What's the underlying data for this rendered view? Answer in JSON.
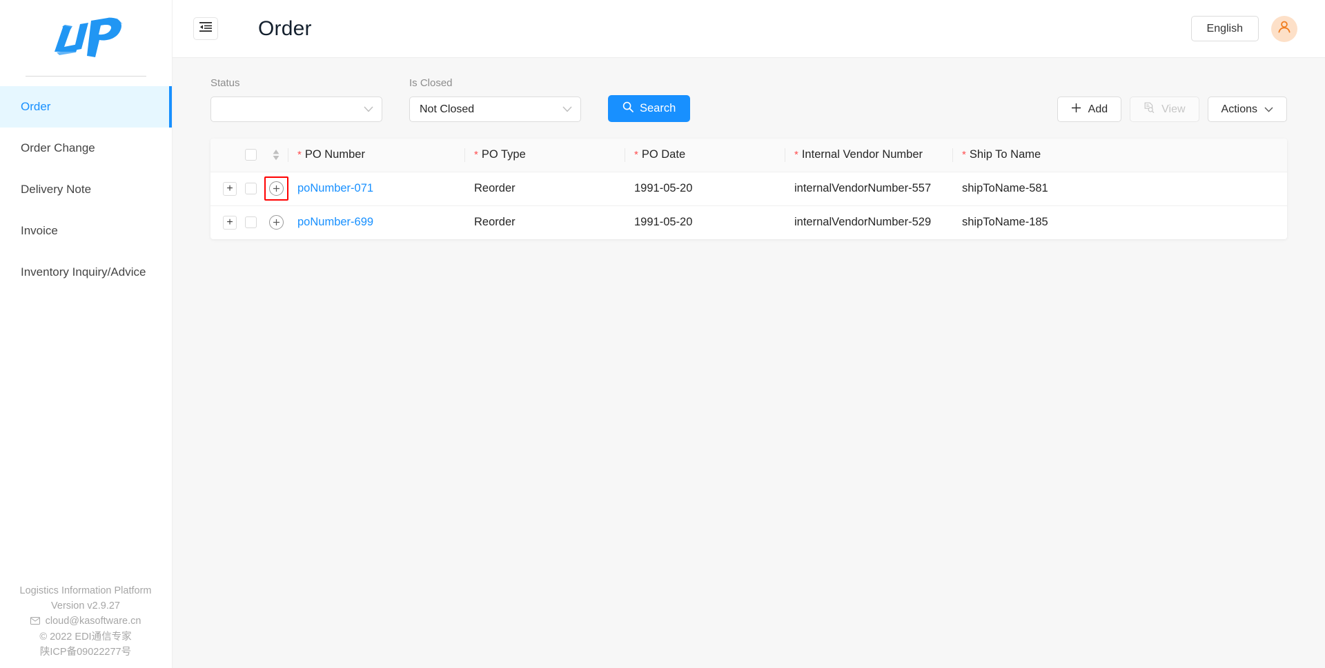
{
  "sidebar": {
    "logo_text": "LIP",
    "items": [
      {
        "label": "Order",
        "active": true
      },
      {
        "label": "Order Change",
        "active": false
      },
      {
        "label": "Delivery Note",
        "active": false
      },
      {
        "label": "Invoice",
        "active": false
      },
      {
        "label": "Inventory Inquiry/Advice",
        "active": false
      }
    ],
    "footer": {
      "platform": "Logistics Information Platform",
      "version": "Version v2.9.27",
      "email": "cloud@kasoftware.cn",
      "copyright": "© 2022 EDI通信专家",
      "icp": "陕ICP备09022277号"
    }
  },
  "topbar": {
    "collapse_icon": "menu-fold-icon",
    "title": "Order",
    "language_label": "English",
    "avatar_icon": "user-icon"
  },
  "filters": {
    "status": {
      "label": "Status",
      "value": "",
      "placeholder": ""
    },
    "is_closed": {
      "label": "Is Closed",
      "value": "Not Closed"
    },
    "search_label": "Search",
    "search_icon": "search-icon"
  },
  "toolbar": {
    "add_label": "Add",
    "add_icon": "plus-icon",
    "view_label": "View",
    "view_icon": "file-search-icon",
    "view_disabled": true,
    "actions_label": "Actions",
    "actions_icon": "chevron-down-icon"
  },
  "table": {
    "columns": [
      {
        "key": "expand",
        "label": ""
      },
      {
        "key": "check",
        "label": ""
      },
      {
        "key": "sort",
        "label": ""
      },
      {
        "key": "po_number",
        "label": "PO Number",
        "required": true
      },
      {
        "key": "po_type",
        "label": "PO Type",
        "required": true
      },
      {
        "key": "po_date",
        "label": "PO Date",
        "required": true
      },
      {
        "key": "internal_vendor_number",
        "label": "Internal Vendor Number",
        "required": true
      },
      {
        "key": "ship_to_name",
        "label": "Ship To Name",
        "required": true
      }
    ],
    "rows": [
      {
        "po_number": "poNumber-071",
        "po_type": "Reorder",
        "po_date": "1991-05-20",
        "internal_vendor_number": "internalVendorNumber-557",
        "ship_to_name": "shipToName-581",
        "highlighted": true
      },
      {
        "po_number": "poNumber-699",
        "po_type": "Reorder",
        "po_date": "1991-05-20",
        "internal_vendor_number": "internalVendorNumber-529",
        "ship_to_name": "shipToName-185",
        "highlighted": false
      }
    ],
    "required_marker": "*",
    "expand_icon": "plus-icon",
    "row_add_icon": "circle-plus-icon",
    "sort_icon": "sort-arrows-icon"
  },
  "colors": {
    "accent": "#1890ff",
    "required": "#ff4d4f",
    "highlight_box": "#ff0000",
    "avatar_bg": "#fde0c8",
    "avatar_fg": "#f07c1f",
    "page_bg": "#f7f7f7"
  }
}
